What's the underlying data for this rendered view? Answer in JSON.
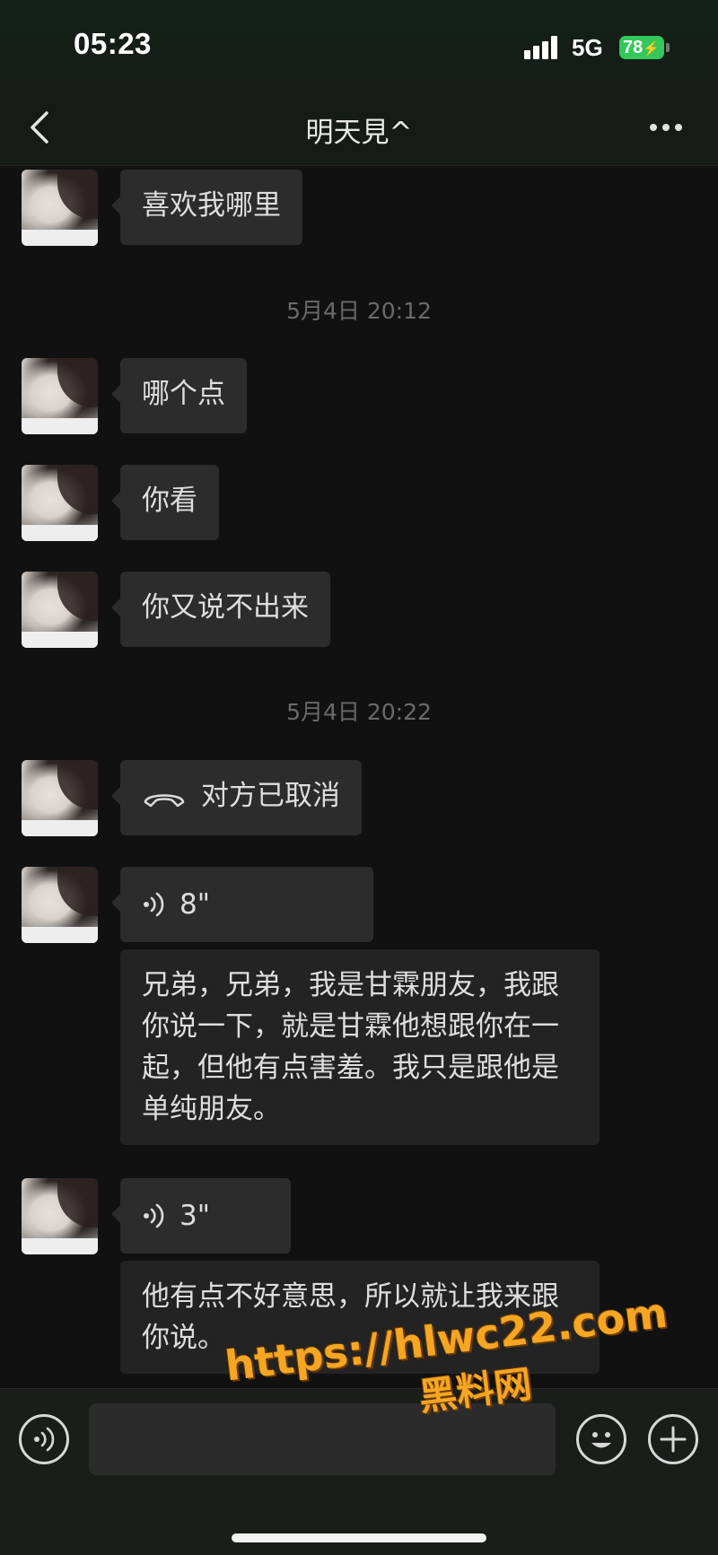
{
  "status_bar": {
    "time": "05:23",
    "network": "5G",
    "battery": "78",
    "battery_color": "#34c759"
  },
  "header": {
    "title": "明天見^",
    "back_icon": "chevron-left-icon",
    "more_icon": "ellipsis-icon"
  },
  "messages": [
    {
      "type": "text",
      "text": "喜欢我哪里"
    },
    {
      "type": "timestamp",
      "text": "5月4日 20:12"
    },
    {
      "type": "text",
      "text": "哪个点"
    },
    {
      "type": "text",
      "text": "你看"
    },
    {
      "type": "text",
      "text": "你又说不出来"
    },
    {
      "type": "timestamp",
      "text": "5月4日 20:22"
    },
    {
      "type": "call",
      "text": "对方已取消",
      "icon": "phone-hangup-icon"
    },
    {
      "type": "voice",
      "duration": "8\"",
      "transcript": "兄弟，兄弟，我是甘霖朋友，我跟你说一下，就是甘霖他想跟你在一起，但他有点害羞。我只是跟他是单纯朋友。"
    },
    {
      "type": "voice",
      "duration": "3\"",
      "transcript": "他有点不好意思，所以就让我来跟你说。"
    }
  ],
  "input_bar": {
    "voice_icon": "voice-input-icon",
    "emoji_icon": "emoji-icon",
    "plus_icon": "plus-icon"
  },
  "watermark": {
    "url": "https://hlwc22.com",
    "site": "黑料网"
  }
}
